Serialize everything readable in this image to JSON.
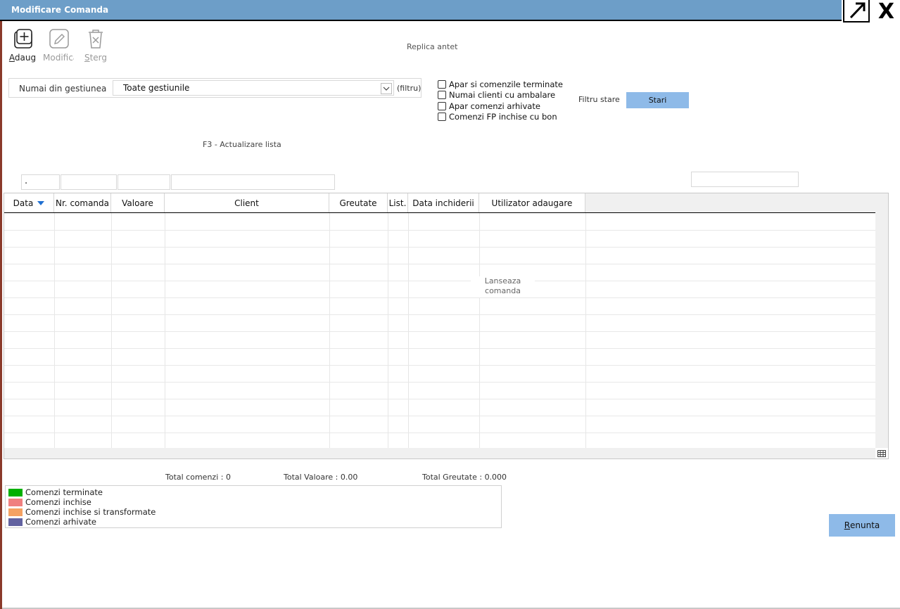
{
  "window": {
    "title": "Modificare Comanda",
    "close_label": "X"
  },
  "toolbar": {
    "add": {
      "label_prefix": "A",
      "label_rest": "daug"
    },
    "edit": {
      "label": "Modifica"
    },
    "delete": {
      "label_prefix": "S",
      "label_rest": "terg"
    }
  },
  "header": {
    "replica": "Replica antet"
  },
  "filter": {
    "gestiune_label": "Numai din gestiunea",
    "gestiune_value": "Toate gestiunile",
    "filtru_label": "(filtru)",
    "checkboxes": [
      {
        "label": "Apar si comenzile terminate",
        "checked": false
      },
      {
        "label": "Numai clienti cu ambalare",
        "checked": false
      },
      {
        "label": "Apar comenzi arhivate",
        "checked": false
      },
      {
        "label": "Comenzi FP inchise cu bon",
        "checked": false
      }
    ],
    "filtru_stare_label": "Filtru stare",
    "stari_button": "Stari"
  },
  "refresh_hint": "F3 - Actualizare lista",
  "search_boxes": {
    "first_value": "."
  },
  "grid": {
    "columns": [
      "Data",
      "Nr. comanda",
      "Valoare",
      "Client",
      "Greutate",
      "List.",
      "Data inchiderii",
      "Utilizator adaugare"
    ],
    "sorted_column": "Data",
    "rows": [],
    "overlay_label_line1": "Lanseaza",
    "overlay_label_line2": "comanda"
  },
  "totals": {
    "comenzi": "Total comenzi :  0",
    "valoare": "Total Valoare : 0.00",
    "greutate": "Total Greutate : 0.000"
  },
  "legend": [
    {
      "label": "Comenzi terminate",
      "color": "#00b000"
    },
    {
      "label": "Comenzi inchise",
      "color": "#f08080"
    },
    {
      "label": "Comenzi inchise si transformate",
      "color": "#f5a262"
    },
    {
      "label": "Comenzi arhivate",
      "color": "#6262a0"
    }
  ],
  "actions": {
    "cancel_prefix": "R",
    "cancel_rest": "enunta"
  },
  "colors": {
    "titlebar": "#6d9ec8",
    "button": "#8ebae8",
    "sort_arrow": "#1f6fd1"
  }
}
